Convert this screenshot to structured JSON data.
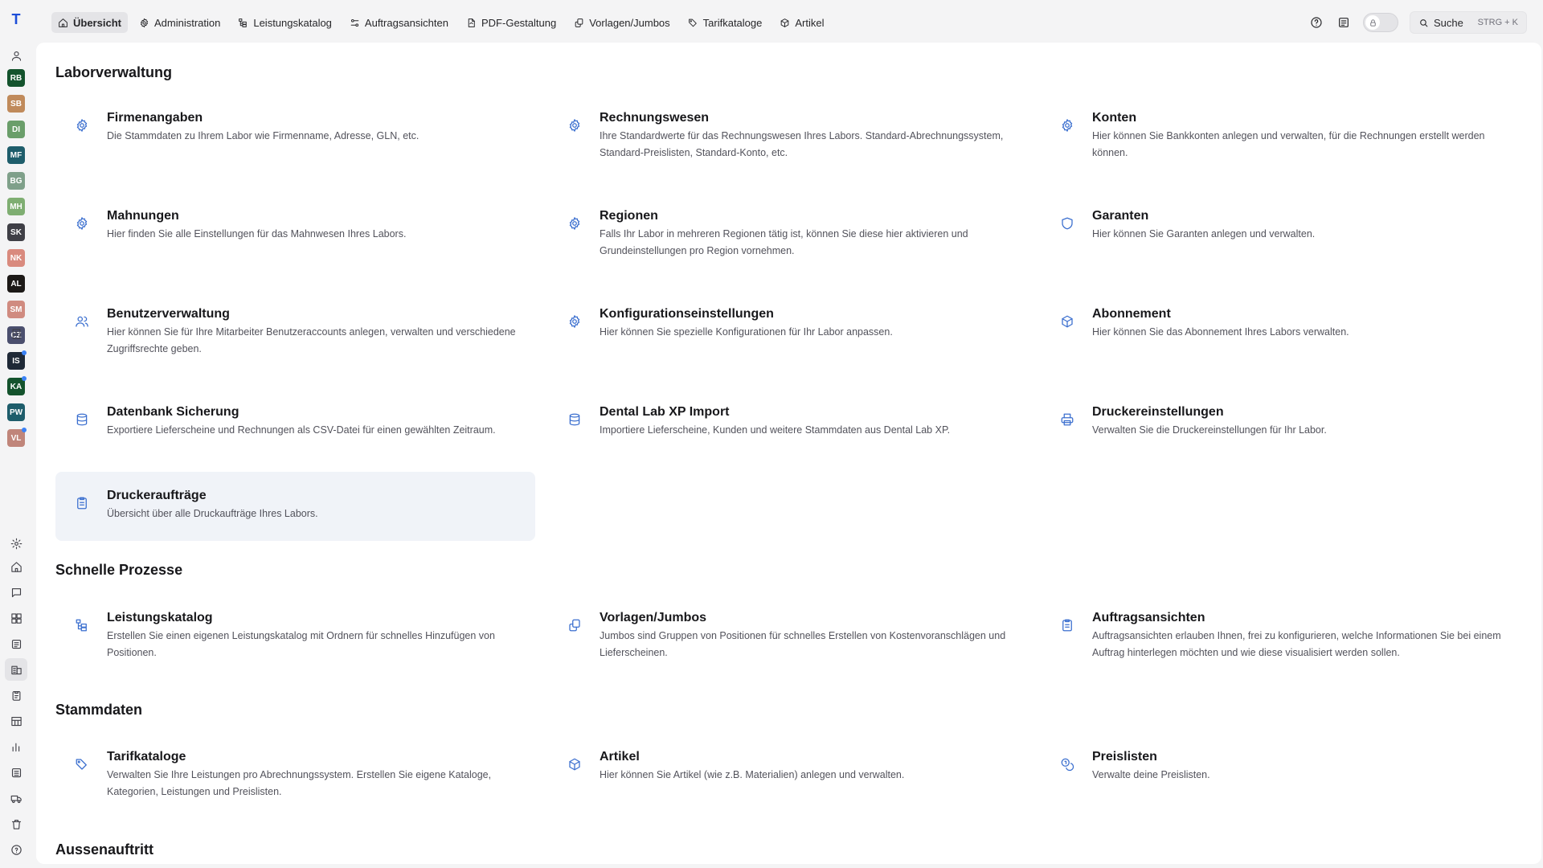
{
  "sidebar": {
    "logo": "T",
    "avatars": [
      {
        "initials": "RB",
        "color": "#14532d",
        "dot": false
      },
      {
        "initials": "SB",
        "color": "#c08a5b",
        "dot": false
      },
      {
        "initials": "DI",
        "color": "#6a9e6a",
        "dot": false
      },
      {
        "initials": "MF",
        "color": "#1e5d6b",
        "dot": false
      },
      {
        "initials": "BG",
        "color": "#7fa08a",
        "dot": false
      },
      {
        "initials": "MH",
        "color": "#7fae72",
        "dot": false
      },
      {
        "initials": "SK",
        "color": "#3f3f46",
        "dot": false
      },
      {
        "initials": "NK",
        "color": "#d98a7e",
        "dot": false
      },
      {
        "initials": "AL",
        "color": "#1c1917",
        "dot": false
      },
      {
        "initials": "SM",
        "color": "#d08b80",
        "dot": false
      },
      {
        "initials": "CZ",
        "color": "#4b4f6e",
        "dot": false
      },
      {
        "initials": "IS",
        "color": "#1f2937",
        "dot": true
      },
      {
        "initials": "KA",
        "color": "#14532d",
        "dot": true
      },
      {
        "initials": "PW",
        "color": "#1e5d6b",
        "dot": false
      },
      {
        "initials": "VL",
        "color": "#c0857a",
        "dot": true
      }
    ]
  },
  "topnav": {
    "tabs": [
      {
        "label": "Übersicht",
        "icon": "home-icon",
        "active": true
      },
      {
        "label": "Administration",
        "icon": "gear-icon",
        "active": false
      },
      {
        "label": "Leistungskatalog",
        "icon": "tree-icon",
        "active": false
      },
      {
        "label": "Auftragsansichten",
        "icon": "sliders-icon",
        "active": false
      },
      {
        "label": "PDF-Gestaltung",
        "icon": "file-icon",
        "active": false
      },
      {
        "label": "Vorlagen/Jumbos",
        "icon": "copy-icon",
        "active": false
      },
      {
        "label": "Tarifkataloge",
        "icon": "tags-icon",
        "active": false
      },
      {
        "label": "Artikel",
        "icon": "box-icon",
        "active": false
      }
    ],
    "search_label": "Suche",
    "search_shortcut": "STRG + K"
  },
  "sections": {
    "laborverwaltung": {
      "title": "Laborverwaltung",
      "cards": [
        {
          "title": "Firmenangaben",
          "desc": "Die Stammdaten zu Ihrem Labor wie Firmenname, Adresse, GLN, etc.",
          "icon": "gear-icon"
        },
        {
          "title": "Rechnungswesen",
          "desc": "Ihre Standardwerte für das Rechnungswesen Ihres Labors. Standard-Abrechnungssystem, Standard-Preislisten, Standard-Konto, etc.",
          "icon": "gear-icon"
        },
        {
          "title": "Konten",
          "desc": "Hier können Sie Bankkonten anlegen und verwalten, für die Rechnungen erstellt werden können.",
          "icon": "gear-icon"
        },
        {
          "title": "Mahnungen",
          "desc": "Hier finden Sie alle Einstellungen für das Mahnwesen Ihres Labors.",
          "icon": "gear-icon"
        },
        {
          "title": "Regionen",
          "desc": "Falls Ihr Labor in mehreren Regionen tätig ist, können Sie diese hier aktivieren und Grundeinstellungen pro Region vornehmen.",
          "icon": "gear-icon"
        },
        {
          "title": "Garanten",
          "desc": "Hier können Sie Garanten anlegen und verwalten.",
          "icon": "shield-icon"
        },
        {
          "title": "Benutzerverwaltung",
          "desc": "Hier können Sie für Ihre Mitarbeiter Benutzeraccounts anlegen, verwalten und verschiedene Zugriffsrechte geben.",
          "icon": "users-icon"
        },
        {
          "title": "Konfigurationseinstellungen",
          "desc": "Hier können Sie spezielle Konfigurationen für Ihr Labor anpassen.",
          "icon": "gear-icon"
        },
        {
          "title": "Abonnement",
          "desc": "Hier können Sie das Abonnement Ihres Labors verwalten.",
          "icon": "box-icon"
        },
        {
          "title": "Datenbank Sicherung",
          "desc": "Exportiere Lieferscheine und Rechnungen als CSV-Datei für einen gewählten Zeitraum.",
          "icon": "database-icon"
        },
        {
          "title": "Dental Lab XP Import",
          "desc": "Importiere Lieferscheine, Kunden und weitere Stammdaten aus Dental Lab XP.",
          "icon": "database-icon"
        },
        {
          "title": "Druckereinstellungen",
          "desc": "Verwalten Sie die Druckereinstellungen für Ihr Labor.",
          "icon": "printer-icon"
        },
        {
          "title": "Druckeraufträge",
          "desc": "Übersicht über alle Druckaufträge Ihres Labors.",
          "icon": "clipboard-icon",
          "active": true
        }
      ]
    },
    "schnelle": {
      "title": "Schnelle Prozesse",
      "cards": [
        {
          "title": "Leistungskatalog",
          "desc": "Erstellen Sie einen eigenen Leistungskatalog mit Ordnern für schnelles Hinzufügen von Positionen.",
          "icon": "tree-icon"
        },
        {
          "title": "Vorlagen/Jumbos",
          "desc": "Jumbos sind Gruppen von Positionen für schnelles Erstellen von Kostenvoranschlägen und Lieferscheinen.",
          "icon": "copy-icon"
        },
        {
          "title": "Auftragsansichten",
          "desc": "Auftragsansichten erlauben Ihnen, frei zu konfigurieren, welche Informationen Sie bei einem Auftrag hinterlegen möchten und wie diese visualisiert werden sollen.",
          "icon": "clipboard-icon"
        }
      ]
    },
    "stammdaten": {
      "title": "Stammdaten",
      "cards": [
        {
          "title": "Tarifkataloge",
          "desc": "Verwalten Sie Ihre Leistungen pro Abrechnungssystem. Erstellen Sie eigene Kataloge, Kategorien, Leistungen und Preislisten.",
          "icon": "tags-icon"
        },
        {
          "title": "Artikel",
          "desc": "Hier können Sie Artikel (wie z.B. Materialien) anlegen und verwalten.",
          "icon": "box-icon"
        },
        {
          "title": "Preislisten",
          "desc": "Verwalte deine Preislisten.",
          "icon": "coins-icon"
        }
      ]
    },
    "aussen": {
      "title": "Aussenauftritt"
    }
  },
  "colors": {
    "accent": "#3b6fcf",
    "brand": "#1d4ed8"
  }
}
